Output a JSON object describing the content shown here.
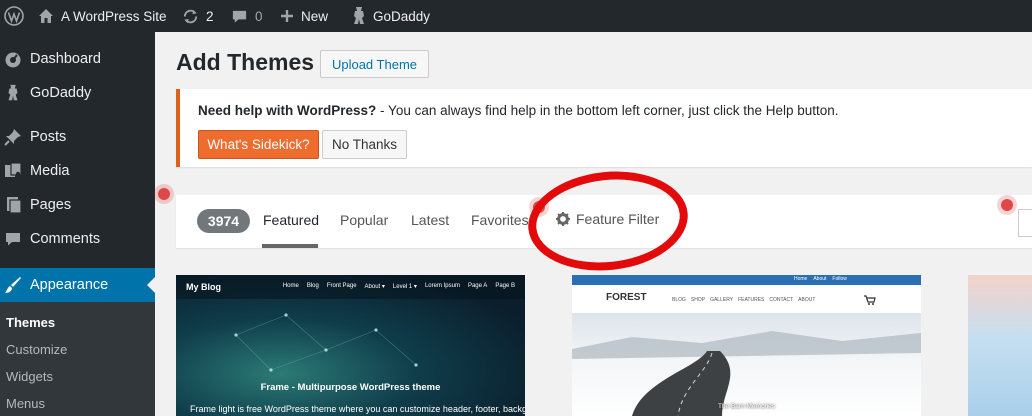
{
  "admin_bar": {
    "site_name": "A WordPress Site",
    "updates_count": "2",
    "comments_count": "0",
    "new_label": "New",
    "godaddy_label": "GoDaddy"
  },
  "sidebar": {
    "items": [
      {
        "label": "Dashboard",
        "icon": "dashboard-icon"
      },
      {
        "label": "GoDaddy",
        "icon": "godaddy-icon"
      },
      {
        "label": "Posts",
        "icon": "pin-icon"
      },
      {
        "label": "Media",
        "icon": "media-icon"
      },
      {
        "label": "Pages",
        "icon": "pages-icon"
      },
      {
        "label": "Comments",
        "icon": "comment-icon"
      },
      {
        "label": "Appearance",
        "icon": "brush-icon",
        "active": true
      }
    ],
    "submenu": [
      "Themes",
      "Customize",
      "Widgets",
      "Menus"
    ],
    "active_color": "#0073aa"
  },
  "page": {
    "title": "Add Themes",
    "upload_button": "Upload Theme"
  },
  "notice": {
    "bold_text": "Need help with WordPress?",
    "text": " - You can always find help in the bottom left corner, just click the Help button.",
    "primary_button": "What's Sidekick?",
    "secondary_button": "No Thanks",
    "accent_color": "#ef6c2f"
  },
  "filter": {
    "count": "3974",
    "tabs": [
      "Featured",
      "Popular",
      "Latest",
      "Favorites"
    ],
    "current_tab": "Featured",
    "feature_filter": "Feature Filter"
  },
  "themes": [
    {
      "blog_name": "My Blog",
      "nav": [
        "Home",
        "Blog",
        "Front Page",
        "About ▾",
        "Level 1 ▾",
        "Lorem Ipsum",
        "Page A",
        "Page B"
      ],
      "title": "Frame - Multipurpose WordPress theme",
      "description": "Frame light is free WordPress theme where you can customize header, footer, backgroud"
    },
    {
      "logo": "FOREST",
      "top_links": [
        "Home",
        "About",
        "Follow"
      ],
      "nav": [
        "BLOG",
        "SHOP",
        "GALLERY",
        "FEATURES",
        "CONTACT",
        "ABOUT"
      ],
      "caption": "The Barn Memories"
    }
  ]
}
